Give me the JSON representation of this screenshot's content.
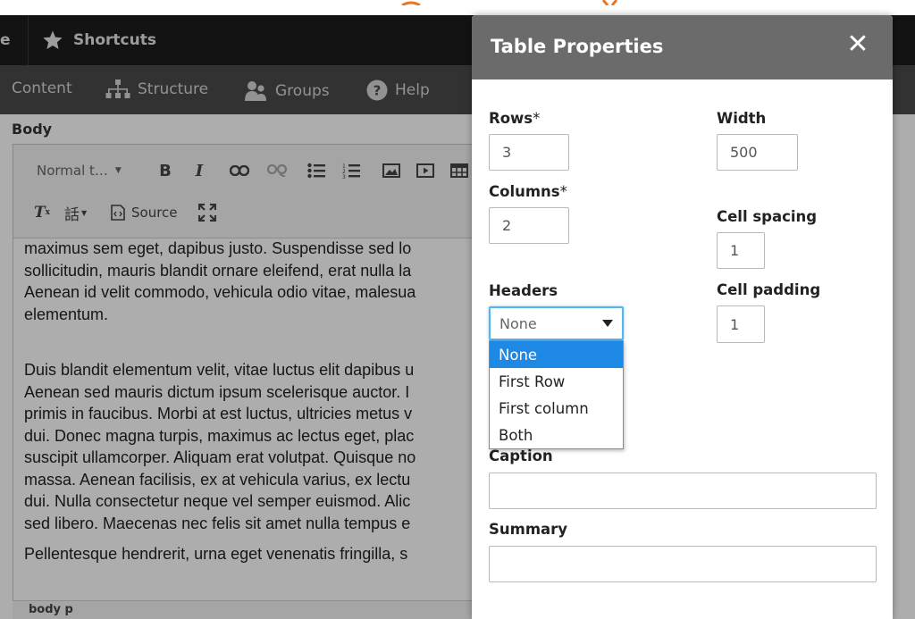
{
  "colors": {
    "toolbar_dark": "#1c1c1c",
    "toolbar_secondary": "#4a4a4a",
    "dialog_header": "#6b6b6b",
    "focus_blue": "#56b4ef",
    "selected_option": "#1e88e5",
    "accent_orange": "#e87722"
  },
  "admin_toolbar": {
    "truncated_label": "e",
    "shortcuts": {
      "label": "Shortcuts",
      "icon": "star-icon"
    },
    "menu": [
      {
        "label": "Content",
        "icon": ""
      },
      {
        "label": "Structure",
        "icon": "sitemap-icon"
      },
      {
        "label": "Groups",
        "icon": "groups-icon"
      },
      {
        "label": "Help",
        "icon": "help-icon"
      }
    ]
  },
  "editor": {
    "field_label": "Body",
    "format_dropdown": "Normal t…",
    "source_label": "Source",
    "paragraph1": [
      "maximus sem eget, dapibus justo. Suspendisse sed lo",
      "sollicitudin, mauris blandit ornare eleifend, erat nulla la",
      "Aenean id velit commodo, vehicula odio vitae, malesua",
      "elementum."
    ],
    "paragraph2": [
      "Duis blandit elementum velit, vitae luctus elit dapibus u",
      "Aenean sed mauris dictum ipsum scelerisque auctor. I",
      "primis in faucibus. Morbi at est luctus, ultricies metus v",
      "dui. Donec magna turpis, maximus ac lectus eget, plac",
      "suscipit ullamcorper. Aliquam erat volutpat. Quisque no",
      "massa. Aenean facilisis, ex at vehicula varius, ex lectu",
      "dui. Nulla consectetur neque vel semper euismod. Alic",
      "sed libero. Maecenas nec felis sit amet nulla tempus e"
    ],
    "paragraph3": "Pellentesque hendrerit, urna eget venenatis fringilla, s",
    "status_path": "body   p"
  },
  "dialog": {
    "title": "Table Properties",
    "close_glyph": "✕",
    "rows_label": "Rows",
    "columns_label": "Columns",
    "required_mark": "*",
    "rows_value": "3",
    "columns_value": "2",
    "width_label": "Width",
    "width_value": "500",
    "cell_spacing_label": "Cell spacing",
    "cell_spacing_value": "1",
    "cell_padding_label": "Cell padding",
    "cell_padding_value": "1",
    "headers_label": "Headers",
    "headers_selected": "None",
    "headers_options": [
      "None",
      "First Row",
      "First column",
      "Both"
    ],
    "caption_label": "Caption",
    "caption_value": "",
    "summary_label": "Summary",
    "summary_value": ""
  }
}
